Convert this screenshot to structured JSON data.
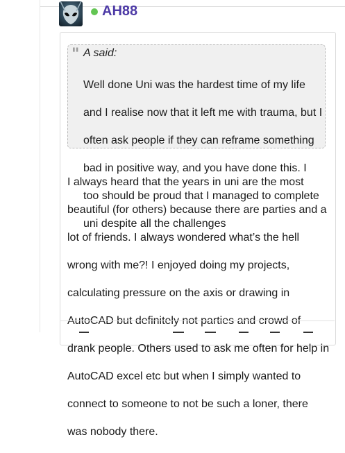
{
  "post": {
    "username": "AH88",
    "quote": {
      "author": "A said:",
      "lines": [
        "Well done Uni was the hardest time of my life",
        "and I realise now that it left me with trauma, but I",
        "often ask people if they can reframe something",
        "bad in positive way, and you have done this. I",
        "too should be proud that I managed to complete",
        "uni despite all the challenges"
      ]
    },
    "reply_lines": [
      "I always heard that the years in uni are the most",
      "beautiful (for others) because there are parties and a",
      "lot of friends. I always wondered what’s the hell",
      "wrong with me?! I enjoyed doing my projects,",
      "calculating pressure on the axis or drawing in",
      "AutoCAD but definitely not parties and crowd of",
      "drank people. Others used to ask me often for help in",
      "AutoCAD excel etc but when I simply wanted to",
      "connect to someone to not be such a loner, there",
      "was nobody there."
    ]
  },
  "colors": {
    "username": "#4d3aa6",
    "online": "#63c553",
    "quote_bg": "#f0f0f0"
  },
  "icons": [
    "alien-avatar",
    "online-status-dot",
    "quote-icon",
    "toolbar-align-icon",
    "toolbar-list-icon"
  ]
}
